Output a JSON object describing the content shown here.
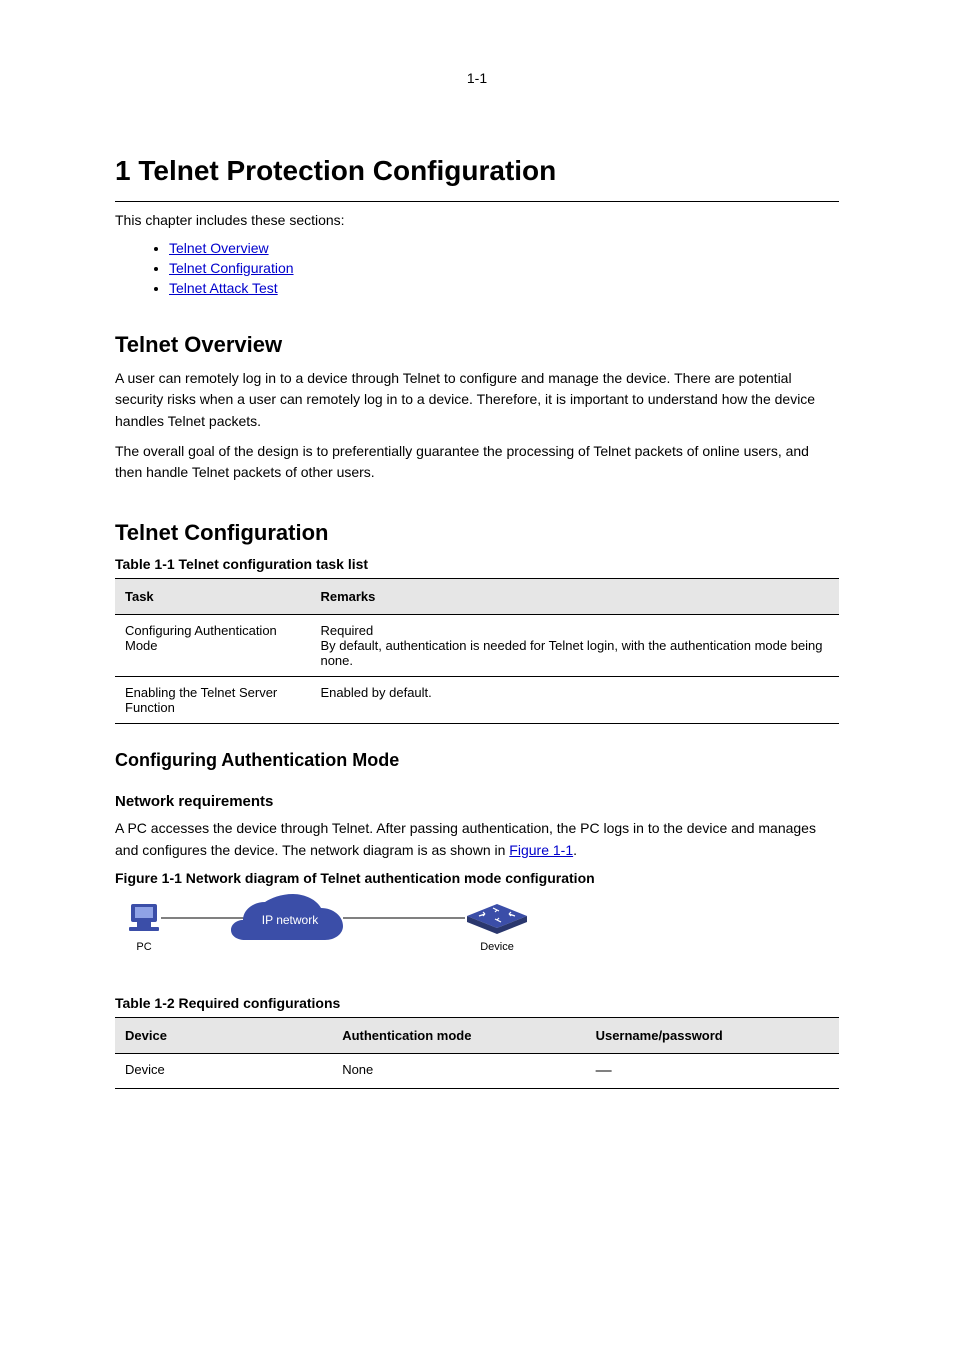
{
  "page_number": "1-1",
  "chapter_title": "1 Telnet Protection Configuration",
  "intro": "This chapter includes these sections:",
  "toc": [
    {
      "label": "Telnet Overview",
      "href": "#"
    },
    {
      "label": "Telnet Configuration",
      "href": "#"
    },
    {
      "label": "Telnet Attack Test",
      "href": "#"
    }
  ],
  "section_overview": {
    "heading": "Telnet Overview",
    "para1": "A user can remotely log in to a device through Telnet to configure and manage the device. There are potential security risks when a user can remotely log in to a device. Therefore, it is important to understand how the device handles Telnet packets.",
    "para2": "The overall goal of the design is to preferentially guarantee the processing of Telnet packets of online users, and then handle Telnet packets of other users."
  },
  "section_config": {
    "heading": "Telnet Configuration",
    "table_caption": "Table 1-1 Telnet configuration task list",
    "table": {
      "headers": [
        "Task",
        "Remarks"
      ],
      "rows": [
        {
          "task": "Configuring Authentication Mode",
          "remarks": [
            "Required",
            "By default, authentication is needed for Telnet login, with the authentication mode being none."
          ]
        },
        {
          "task": "Enabling the Telnet Server Function",
          "remarks": [
            "Enabled by default."
          ]
        }
      ]
    }
  },
  "config_auth": {
    "heading": "Configuring Authentication Mode",
    "requirements_heading": "Network requirements",
    "req_text_pre": "A PC accesses the device through Telnet. After passing authentication, the PC logs in to the device and manages and configures the device. The network diagram is as shown in ",
    "figure_link_text": "Figure 1-1",
    "req_text_post": ".",
    "fig_caption": "Figure 1-1 Network diagram of Telnet authentication mode configuration",
    "figure": {
      "pc_label": "PC",
      "net_label": "IP network",
      "dev_label": "Device"
    },
    "settings_caption": "Table 1-2 Required configurations",
    "settings_table": {
      "headers": [
        "Device",
        "Authentication mode",
        "Username/password"
      ],
      "rows": [
        {
          "device": "Device",
          "mode": "None",
          "creds": "—"
        }
      ]
    }
  }
}
